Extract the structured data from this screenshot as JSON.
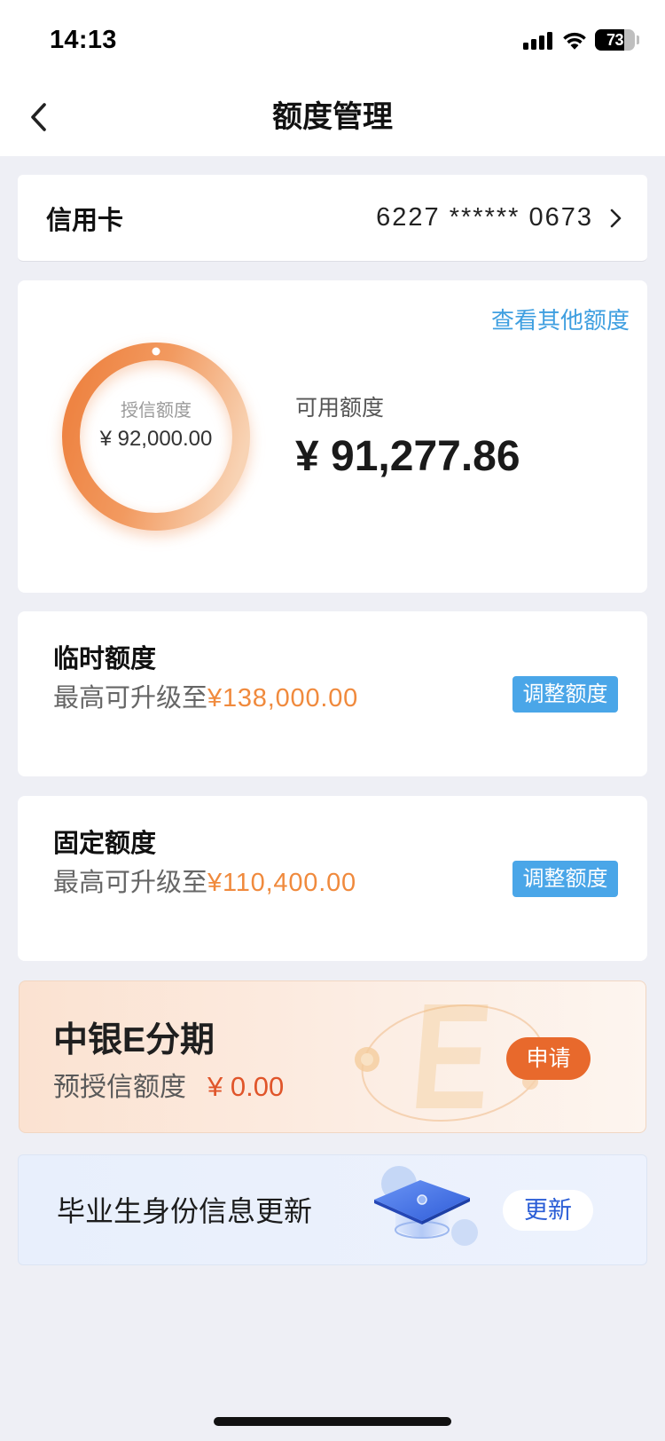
{
  "status_bar": {
    "time": "14:13",
    "battery": "73"
  },
  "nav": {
    "title": "额度管理"
  },
  "account": {
    "label": "信用卡",
    "number": "6227 ****** 0673"
  },
  "summary": {
    "other_limits_link": "查看其他额度",
    "credit_label": "授信额度",
    "credit_value": "¥ 92,000.00",
    "available_label": "可用额度",
    "available_value": "¥ 91,277.86"
  },
  "limits": [
    {
      "title": "临时额度",
      "desc": "最高可升级至",
      "amount": "¥138,000.00",
      "button": "调整额度"
    },
    {
      "title": "固定额度",
      "desc": "最高可升级至",
      "amount": "¥110,400.00",
      "button": "调整额度"
    }
  ],
  "installment": {
    "title": "中银E分期",
    "desc": "预授信额度",
    "amount": "¥ 0.00",
    "button": "申请",
    "decor_letter": "E"
  },
  "graduate": {
    "title": "毕业生身份信息更新",
    "button": "更新"
  },
  "icons": {
    "signal": "cellular-signal-icon",
    "wifi": "wifi-icon",
    "battery": "battery-icon",
    "back": "chevron-left-icon",
    "account_arrow": "chevron-right-icon",
    "graduate": "graduation-cap-icon"
  },
  "colors": {
    "page_bg": "#eeeff5",
    "link_blue": "#3f9fe0",
    "button_blue": "#4aa6e8",
    "amount_orange": "#f08a3d",
    "apply_orange": "#e8692c",
    "zero_amount_red": "#e0552a",
    "update_blue": "#2a5dd6",
    "ring_dark": "#ee8443",
    "ring_light": "#f8d3b4"
  }
}
